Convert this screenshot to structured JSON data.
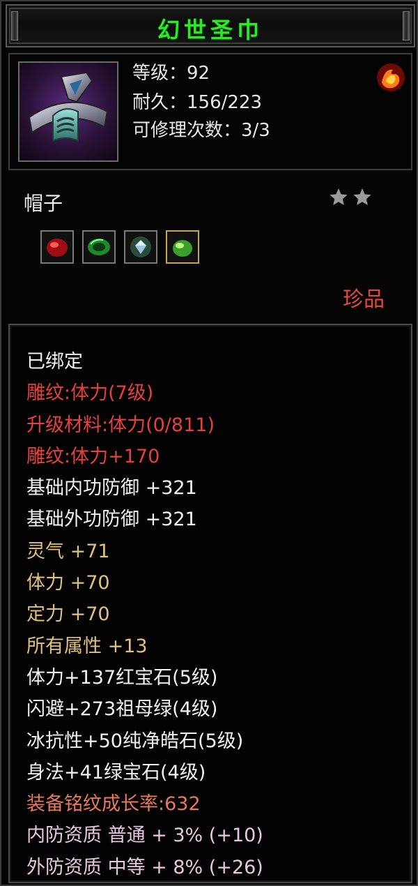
{
  "title": "幻世圣巾",
  "header": {
    "level": "等级：92",
    "durability": "耐久：156/223",
    "repairs": "可修理次数：3/3"
  },
  "item_type": "帽子",
  "stars": 2,
  "gems": [
    "ruby-gem-icon",
    "emerald-gem-icon",
    "diamond-gem-icon",
    "green-gem-icon"
  ],
  "rarity": "珍品",
  "colors": {
    "title": "#2ee82a",
    "white": "#f2f2f2",
    "red": "#e8403a",
    "gold": "#e2c27a",
    "salmon": "#e87a5a",
    "pink": "#e8c8e0"
  },
  "attributes": [
    {
      "text": "已绑定",
      "color": "#f2f2f2"
    },
    {
      "text": "雕纹:体力(7级)",
      "color": "#e8403a"
    },
    {
      "text": "升级材料:体力(0/811)",
      "color": "#e8403a"
    },
    {
      "text": "雕纹:体力+170",
      "color": "#e8403a"
    },
    {
      "text": "基础内功防御 +321",
      "color": "#f2f2f2"
    },
    {
      "text": "基础外功防御 +321",
      "color": "#f2f2f2"
    },
    {
      "text": "灵气 +71",
      "color": "#e2c27a"
    },
    {
      "text": "体力 +70",
      "color": "#e2c27a"
    },
    {
      "text": "定力 +70",
      "color": "#e2c27a"
    },
    {
      "text": "所有属性 +13",
      "color": "#e2c27a"
    },
    {
      "text": "体力+137红宝石(5级)",
      "color": "#f2f2f2"
    },
    {
      "text": "闪避+273祖母绿(4级)",
      "color": "#f2f2f2"
    },
    {
      "text": "冰抗性+50纯净皓石(5级)",
      "color": "#f2f2f2"
    },
    {
      "text": "身法+41绿宝石(4级)",
      "color": "#f2f2f2"
    },
    {
      "text": "装备铭纹成长率:632",
      "color": "#e87a5a"
    },
    {
      "text": "内防资质 普通 + 3% (+10)",
      "color": "#e8c8e0"
    },
    {
      "text": "外防资质 中等 + 8% (+26)",
      "color": "#e8c8e0"
    }
  ]
}
